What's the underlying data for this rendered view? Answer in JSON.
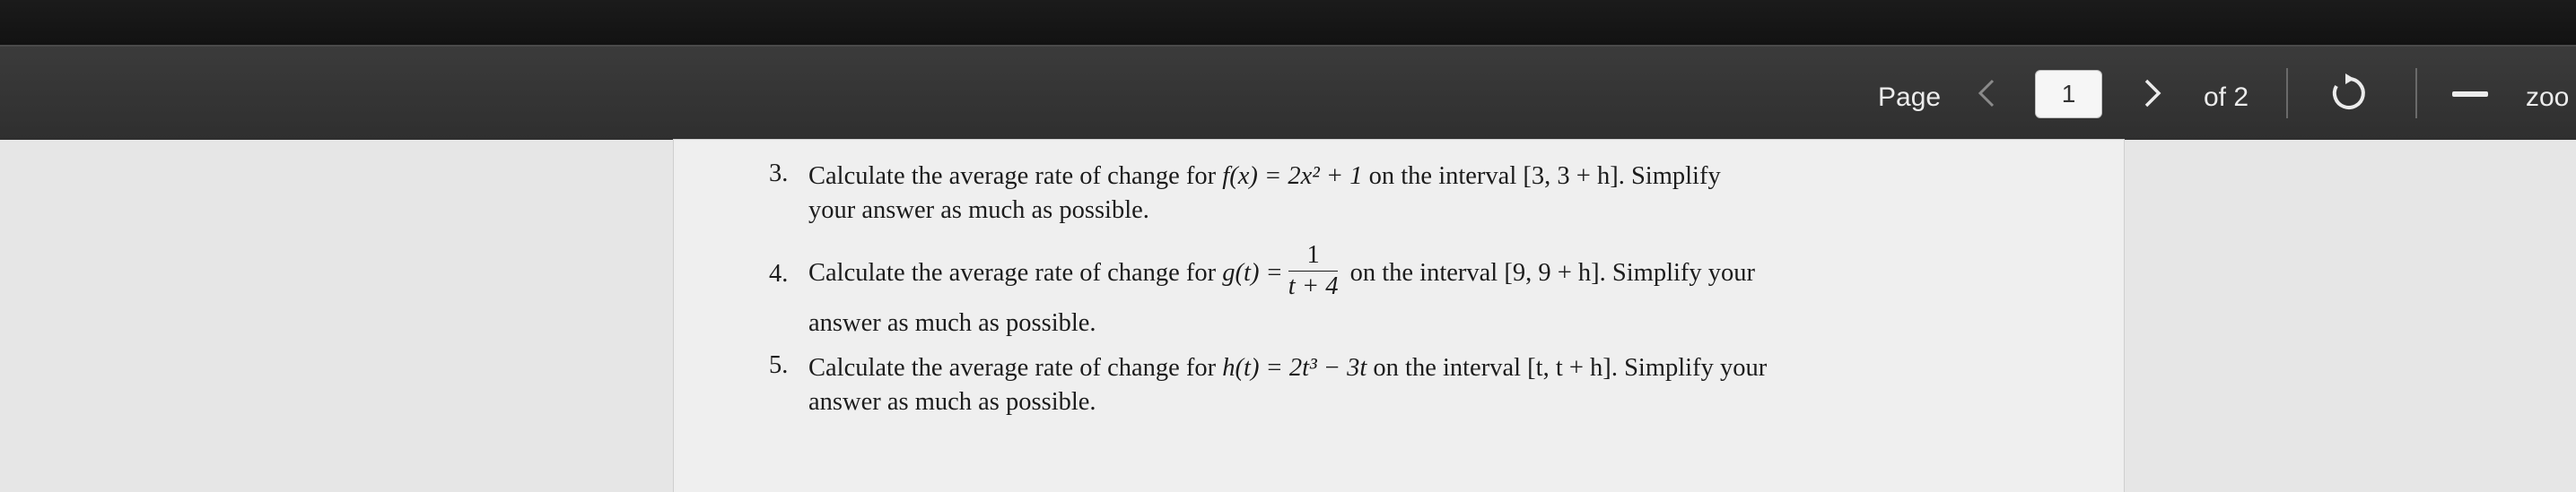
{
  "toolbar": {
    "page_label": "Page",
    "current_page": "1",
    "of_label": "of 2",
    "zoom_label": "zoo"
  },
  "questions": [
    {
      "number": "3.",
      "line1_a": "Calculate the average rate of change for ",
      "line1_math": "f(x) = 2x² + 1",
      "line1_b": " on the interval ",
      "line1_interval": "[3, 3 + h]",
      "line1_c": ". Simplify",
      "line2": "your answer as much as possible."
    },
    {
      "number": "4.",
      "line1_a": "Calculate the average rate of change for ",
      "line1_lhs": "g(t) =",
      "frac_num": "1",
      "frac_den": "t + 4",
      "line1_b": " on the interval ",
      "line1_interval": "[9, 9 + h]",
      "line1_c": ". Simplify your",
      "line2": "answer as much as possible."
    },
    {
      "number": "5.",
      "line1_a": "Calculate the average rate of change for ",
      "line1_math": "h(t) = 2t³ − 3t",
      "line1_b": " on the interval ",
      "line1_interval": "[t, t + h]",
      "line1_c": ". Simplify your",
      "line2": "answer as much as possible."
    }
  ]
}
